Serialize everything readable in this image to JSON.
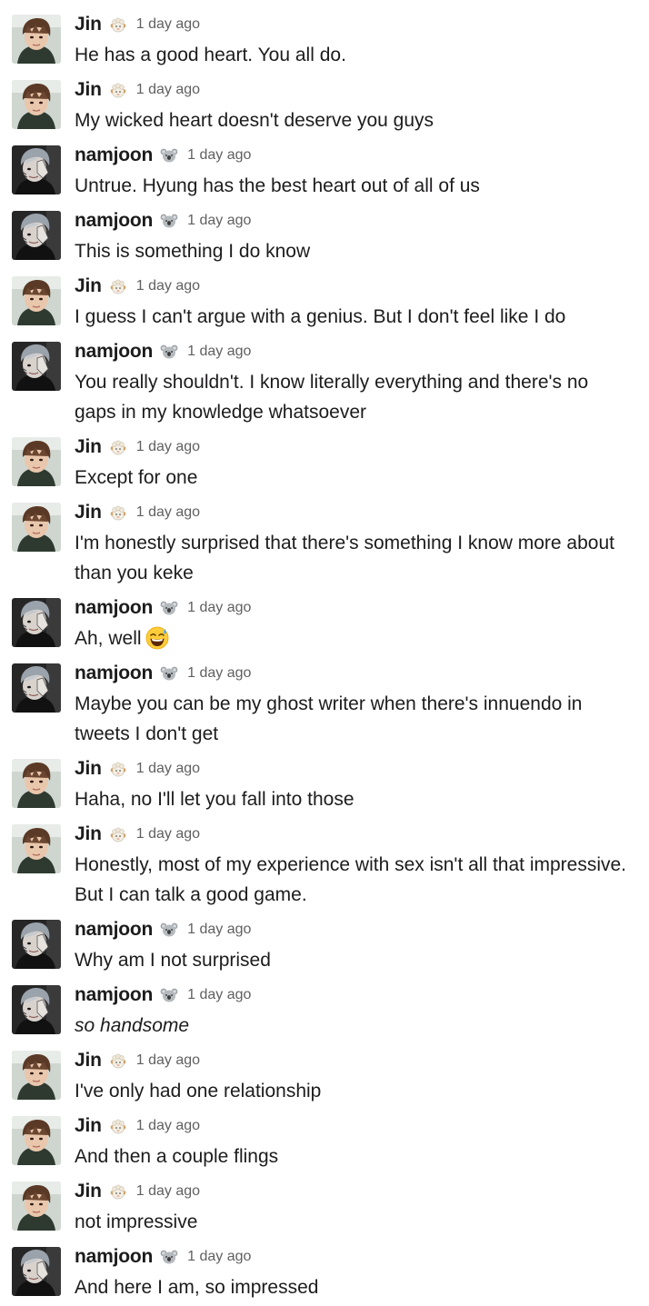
{
  "users": {
    "jin": {
      "name": "Jin",
      "badge_icon": "ram-icon"
    },
    "namjoon": {
      "name": "namjoon",
      "badge_icon": "koala-icon"
    }
  },
  "messages": [
    {
      "user": "Jin",
      "time": "1 day ago",
      "text": "He has a good heart. You all do."
    },
    {
      "user": "Jin",
      "time": "1 day ago",
      "text": "My wicked heart doesn't deserve you guys"
    },
    {
      "user": "namjoon",
      "time": "1 day ago",
      "text": "Untrue. Hyung has the best heart out of all of us"
    },
    {
      "user": "namjoon",
      "time": "1 day ago",
      "text": "This is something I do know"
    },
    {
      "user": "Jin",
      "time": "1 day ago",
      "text": "I guess I can't argue with a genius. But I don't feel like I do"
    },
    {
      "user": "namjoon",
      "time": "1 day ago",
      "text": "You really shouldn't. I know literally everything and there's no gaps in my knowledge whatsoever"
    },
    {
      "user": "Jin",
      "time": "1 day ago",
      "text": "Except for one"
    },
    {
      "user": "Jin",
      "time": "1 day ago",
      "text": "I'm honestly surprised that there's something I know more about than you keke"
    },
    {
      "user": "namjoon",
      "time": "1 day ago",
      "text": "Ah, well",
      "emoji": "sweat-smile-icon"
    },
    {
      "user": "namjoon",
      "time": "1 day ago",
      "text": "Maybe you can be my ghost writer when there's innuendo in tweets I don't get"
    },
    {
      "user": "Jin",
      "time": "1 day ago",
      "text": "Haha, no I'll let you fall into those"
    },
    {
      "user": "Jin",
      "time": "1 day ago",
      "text": "Honestly, most of my experience with sex isn't all that impressive. But I can talk a good game."
    },
    {
      "user": "namjoon",
      "time": "1 day ago",
      "text": "Why am I not surprised"
    },
    {
      "user": "namjoon",
      "time": "1 day ago",
      "text": "so handsome",
      "style": "italic"
    },
    {
      "user": "Jin",
      "time": "1 day ago",
      "text": "I've only had one relationship"
    },
    {
      "user": "Jin",
      "time": "1 day ago",
      "text": "And then a couple flings"
    },
    {
      "user": "Jin",
      "time": "1 day ago",
      "text": "not impressive"
    },
    {
      "user": "namjoon",
      "time": "1 day ago",
      "text": "And here I am, so impressed"
    }
  ]
}
